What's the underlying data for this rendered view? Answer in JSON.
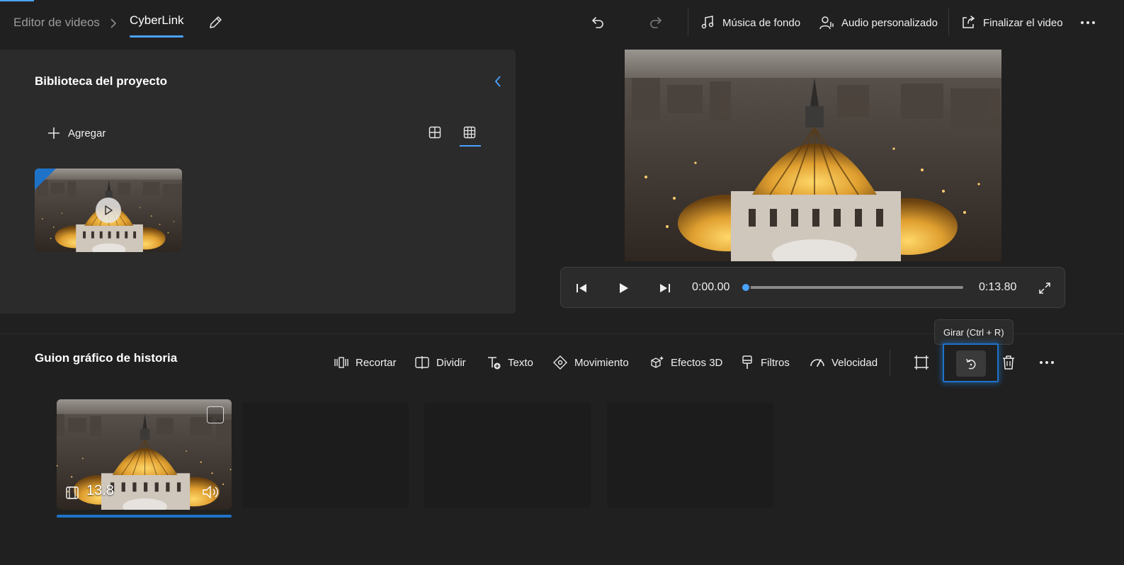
{
  "breadcrumb": {
    "root": "Editor de videos",
    "project": "CyberLink"
  },
  "toolbar": {
    "background_music": "Música de fondo",
    "custom_audio": "Audio personalizado",
    "finish_video": "Finalizar el video"
  },
  "library": {
    "title": "Biblioteca del proyecto",
    "add_label": "Agregar"
  },
  "player": {
    "current_time": "0:00.00",
    "total_time": "0:13.80",
    "progress": 0
  },
  "storyboard": {
    "title": "Guion gráfico de historia",
    "actions": {
      "trim": "Recortar",
      "split": "Dividir",
      "text": "Texto",
      "motion": "Movimiento",
      "effects3d": "Efectos 3D",
      "filters": "Filtros",
      "speed": "Velocidad"
    },
    "tooltip": "Girar (Ctrl + R)",
    "clip_duration": "13.8"
  },
  "icons": [
    "chevron-right-icon",
    "pencil-icon",
    "undo-icon",
    "redo-icon",
    "music-note-icon",
    "person-audio-icon",
    "share-export-icon",
    "more-icon",
    "chevron-left-icon",
    "plus-icon",
    "grid-large-icon",
    "grid-small-icon",
    "play-icon",
    "skip-back-icon",
    "skip-forward-icon",
    "fullscreen-icon",
    "trim-icon",
    "split-icon",
    "text-icon",
    "motion-icon",
    "effects-3d-icon",
    "filters-icon",
    "speed-icon",
    "crop-icon",
    "rotate-icon",
    "trash-icon",
    "film-icon",
    "volume-icon"
  ],
  "colors": {
    "accent": "#4aa3ff",
    "focus": "#1e73c8",
    "background": "#202020",
    "panel": "#2b2b2b"
  }
}
